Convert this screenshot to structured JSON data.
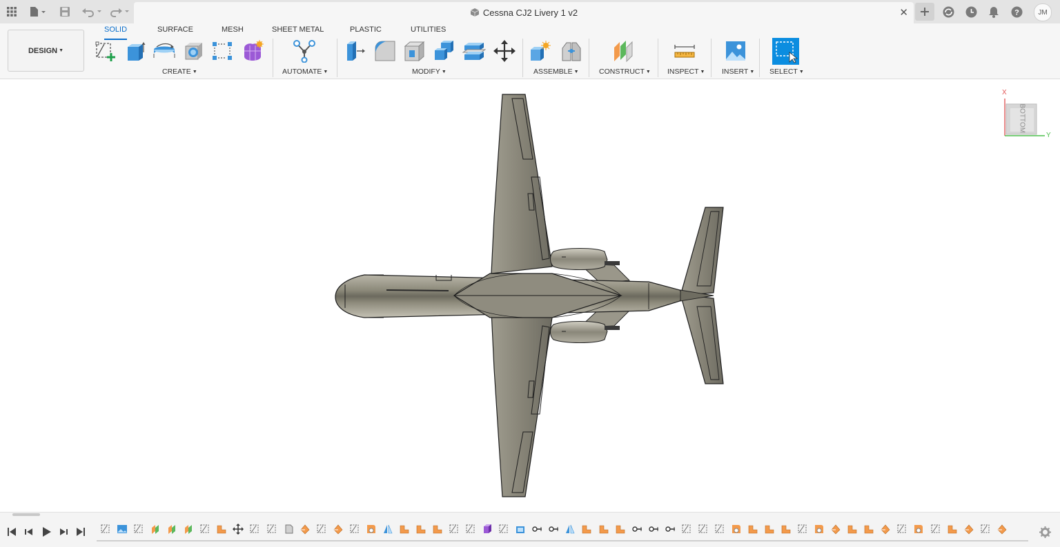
{
  "titlebar": {
    "document_title": "Cessna CJ2 Livery 1 v2",
    "user_initials": "JM"
  },
  "toolbar": {
    "design_label": "DESIGN",
    "tabs": [
      "SOLID",
      "SURFACE",
      "MESH",
      "SHEET METAL",
      "PLASTIC",
      "UTILITIES"
    ],
    "active_tab": "SOLID",
    "groups": {
      "create": "CREATE",
      "automate": "AUTOMATE",
      "modify": "MODIFY",
      "assemble": "ASSEMBLE",
      "construct": "CONSTRUCT",
      "inspect": "INSPECT",
      "insert": "INSERT",
      "select": "SELECT"
    }
  },
  "viewcube": {
    "face": "BOTTOM",
    "axis_x": "X",
    "axis_y": "Y"
  },
  "colors": {
    "accent": "#0a6ecb",
    "aircraft_fill": "#8a8778",
    "select_blue": "#0b8de0",
    "timeline_orange": "#f39a4b"
  },
  "timeline": {
    "features": [
      "sketch",
      "image",
      "sketch",
      "plane",
      "plane",
      "plane",
      "sketch",
      "offset",
      "move",
      "sketch",
      "sketch",
      "body",
      "loft",
      "sketch",
      "loft",
      "sketch",
      "fillet",
      "mirror",
      "offset",
      "offset",
      "offset",
      "sketch",
      "sketch",
      "box",
      "sketch",
      "shell",
      "joint",
      "joint",
      "mirror",
      "offset",
      "offset",
      "offset",
      "joint",
      "joint",
      "joint",
      "sketch",
      "sketch",
      "sketch",
      "fillet",
      "offset",
      "offset",
      "offset",
      "sketch",
      "fillet",
      "loft",
      "offset",
      "offset",
      "loft",
      "sketch",
      "fillet",
      "sketch",
      "offset",
      "loft",
      "sketch",
      "loft"
    ]
  }
}
